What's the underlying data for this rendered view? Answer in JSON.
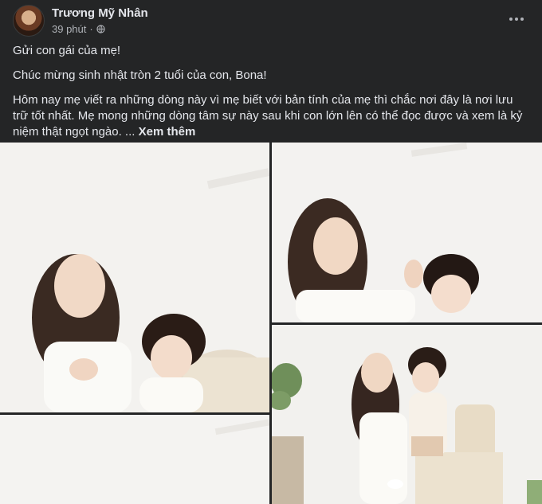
{
  "post": {
    "author": "Trương Mỹ Nhân",
    "time": "39 phút",
    "separator": "·",
    "privacy_icon": "globe-icon",
    "more_icon": "more-options-icon",
    "paragraphs": [
      "Gửi con gái của mẹ!",
      "Chúc mừng sinh nhật tròn 2 tuổi của con, Bona!"
    ],
    "long_paragraph": "Hôm nay mẹ viết ra những dòng này vì mẹ biết với bản tính của mẹ thì chắc nơi đây là nơi lưu trữ tốt nhất. Mẹ mong những dòng tâm sự này sau khi con lớn lên có thể đọc được và xem là kỷ niệm thật ngọt ngào. ...",
    "see_more": "Xem thêm"
  },
  "colors": {
    "background": "#242526",
    "text": "#e4e6eb",
    "secondary_text": "#b0b3b8"
  }
}
